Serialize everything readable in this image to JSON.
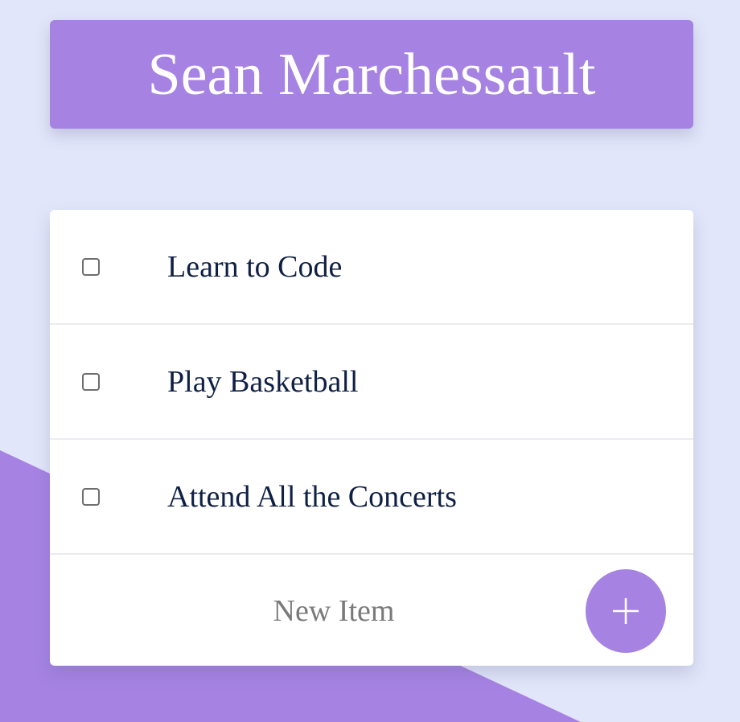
{
  "header": {
    "title": "Sean Marchessault"
  },
  "todo": {
    "items": [
      {
        "label": "Learn to Code",
        "checked": false
      },
      {
        "label": "Play Basketball",
        "checked": false
      },
      {
        "label": "Attend All the Concerts",
        "checked": false
      }
    ],
    "new_item": {
      "placeholder": "New Item",
      "value": ""
    },
    "add_button_icon": "plus-icon"
  },
  "colors": {
    "background": "#e2e6fa",
    "accent": "#a683e3",
    "card": "#ffffff",
    "item_text": "#0f2045",
    "placeholder_text": "#7a7a7a",
    "divider": "#ececf0"
  }
}
